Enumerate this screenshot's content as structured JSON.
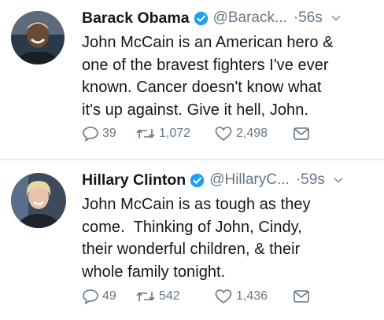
{
  "tweets": [
    {
      "name": "Barack Obama",
      "handle": "@Barack...",
      "time": "·56s",
      "text": "John McCain is an American hero &\none of the bravest fighters I've ever\nknown. Cancer doesn't know what\nit's up against. Give it hell, John.",
      "replies": "39",
      "retweets": "1,072",
      "likes": "2,498"
    },
    {
      "name": "Hillary Clinton",
      "handle": "@HillaryC...",
      "time": "·59s",
      "text": "John McCain is as tough as they\ncome.  Thinking of John, Cindy,\ntheir wonderful children, & their\nwhole family tonight.",
      "replies": "49",
      "retweets": "542",
      "likes": "1,436"
    }
  ],
  "colors": {
    "verified": "#1da1f2",
    "muted": "#657786",
    "divider": "#e6ecf0"
  },
  "icons": [
    "verified-badge-icon",
    "chevron-down-icon",
    "reply-icon",
    "retweet-icon",
    "like-icon",
    "direct-message-icon"
  ]
}
